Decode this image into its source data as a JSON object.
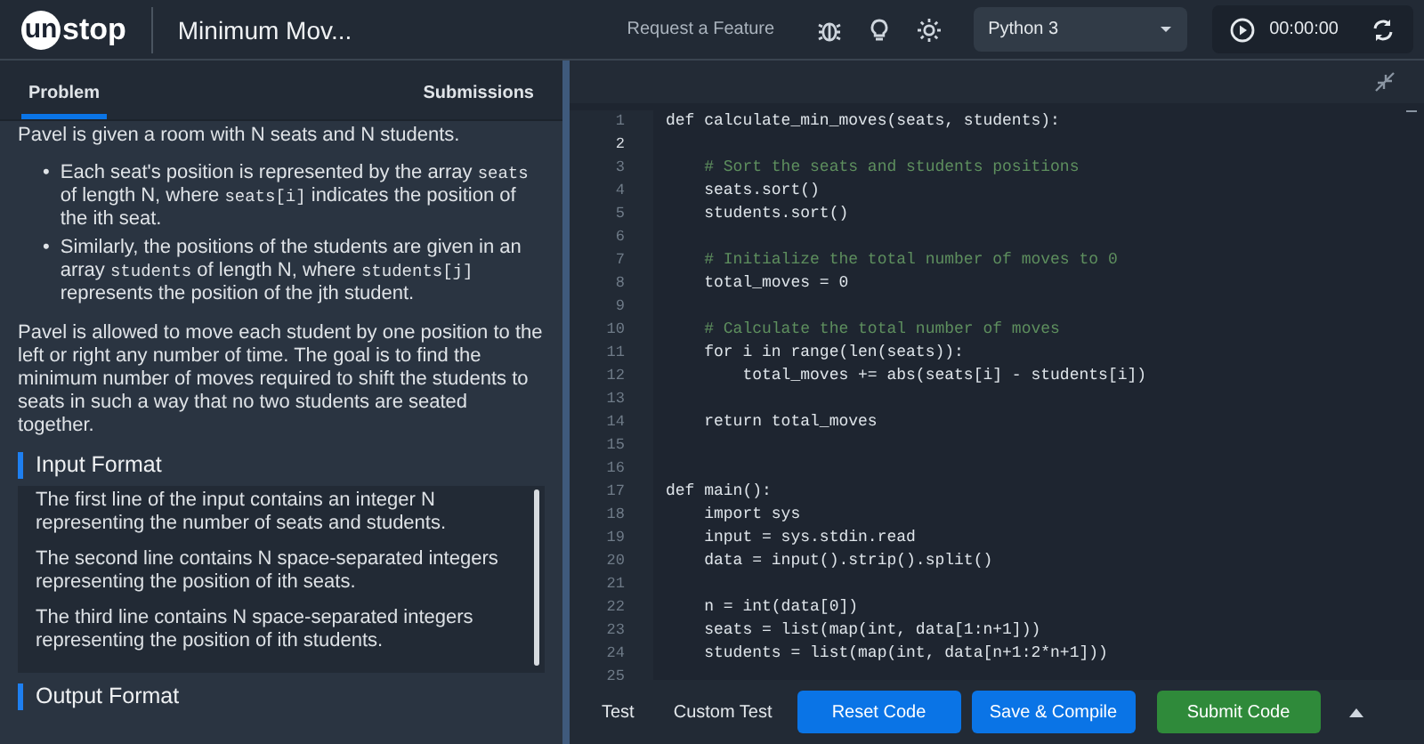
{
  "header": {
    "logo": {
      "badge": "un",
      "text": "stop"
    },
    "title": "Minimum Mov...",
    "request_link": "Request a Feature",
    "language_select": {
      "value": "Python 3"
    },
    "timer": "00:00:00"
  },
  "problem_panel": {
    "tabs": [
      {
        "label": "Problem",
        "selected": true
      },
      {
        "label": "Submissions",
        "selected": false
      }
    ],
    "intro": "Pavel is given a room with N seats and N students.",
    "bullets": [
      {
        "marker": "•",
        "segments": [
          {
            "text": "Each seat's position is represented by the array ",
            "code": false
          },
          {
            "text": "seats",
            "code": true
          },
          {
            "text": " of length N, where ",
            "code": false
          },
          {
            "text": "seats[i]",
            "code": true
          },
          {
            "text": " indicates the position of the ith seat.",
            "code": false
          }
        ]
      },
      {
        "marker": "•",
        "segments": [
          {
            "text": "Similarly, the positions of the students are given in an array ",
            "code": false
          },
          {
            "text": "students",
            "code": true
          },
          {
            "text": " of length N, where ",
            "code": false
          },
          {
            "text": "students[j]",
            "code": true
          },
          {
            "text": " represents the position of the jth student.",
            "code": false
          }
        ]
      }
    ],
    "description": "Pavel is allowed to move each student by one position to the left or right any number of time. The goal is to find the minimum number of moves required to shift the students to seats in such a way that no two students are seated together.",
    "sections": [
      {
        "heading": "Input Format",
        "paragraphs": [
          "The first line of the input contains an integer N representing the number of seats and students.",
          "The second line contains N space-separated integers representing the position of ith seats.",
          "The third line contains N space-separated integers representing the position of ith students."
        ]
      },
      {
        "heading": "Output Format"
      }
    ]
  },
  "editor": {
    "lines": [
      {
        "number": "1",
        "kind": "code",
        "text": "def calculate_min_moves(seats, students):",
        "selected": false
      },
      {
        "number": "2",
        "kind": "blank",
        "selected": true
      },
      {
        "number": "3",
        "kind": "comment",
        "text": "    # Sort the seats and students positions",
        "selected": false
      },
      {
        "number": "4",
        "kind": "code",
        "text": "    seats.sort()",
        "selected": false
      },
      {
        "number": "5",
        "kind": "code",
        "text": "    students.sort()",
        "selected": false
      },
      {
        "number": "6",
        "kind": "blank",
        "selected": false
      },
      {
        "number": "7",
        "kind": "comment",
        "text": "    # Initialize the total number of moves to 0",
        "selected": false
      },
      {
        "number": "8",
        "kind": "code",
        "text": "    total_moves = 0",
        "selected": false
      },
      {
        "number": "9",
        "kind": "blank",
        "selected": false
      },
      {
        "number": "10",
        "kind": "comment",
        "text": "    # Calculate the total number of moves",
        "selected": false
      },
      {
        "number": "11",
        "kind": "code",
        "text": "    for i in range(len(seats)):",
        "selected": false
      },
      {
        "number": "12",
        "kind": "code",
        "text": "        total_moves += abs(seats[i] - students[i])",
        "selected": false
      },
      {
        "number": "13",
        "kind": "blank",
        "selected": false
      },
      {
        "number": "14",
        "kind": "code",
        "text": "    return total_moves",
        "selected": false
      },
      {
        "number": "15",
        "kind": "blank",
        "selected": false
      },
      {
        "number": "16",
        "kind": "blank",
        "selected": false
      },
      {
        "number": "17",
        "kind": "code",
        "text": "def main():",
        "selected": false
      },
      {
        "number": "18",
        "kind": "code",
        "text": "    import sys",
        "selected": false
      },
      {
        "number": "19",
        "kind": "code",
        "text": "    input = sys.stdin.read",
        "selected": false
      },
      {
        "number": "20",
        "kind": "code",
        "text": "    data = input().strip().split()",
        "selected": false
      },
      {
        "number": "21",
        "kind": "blank",
        "selected": false
      },
      {
        "number": "22",
        "kind": "code",
        "text": "    n = int(data[0])",
        "selected": false
      },
      {
        "number": "23",
        "kind": "code",
        "text": "    seats = list(map(int, data[1:n+1]))",
        "selected": false
      },
      {
        "number": "24",
        "kind": "code",
        "text": "    students = list(map(int, data[n+1:2*n+1]))",
        "selected": false
      },
      {
        "number": "25",
        "kind": "blank",
        "selected": false
      }
    ]
  },
  "bottom_bar": {
    "tabs": [
      "Test",
      "Custom Test"
    ],
    "buttons": [
      {
        "label": "Reset Code",
        "kind": "primary"
      },
      {
        "label": "Save & Compile",
        "kind": "primary"
      },
      {
        "label": "Submit Code",
        "kind": "success"
      }
    ]
  }
}
